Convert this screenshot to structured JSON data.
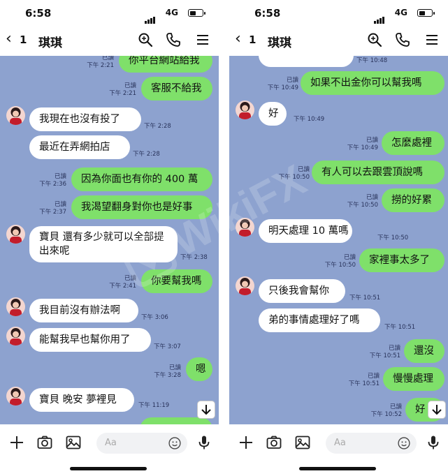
{
  "status_bar": {
    "time": "6:58",
    "network": "4G"
  },
  "chat_header": {
    "back_count": "1",
    "contact_name": "琪琪"
  },
  "composer": {
    "placeholder": "Aa"
  },
  "left_screen": {
    "messages": [
      {
        "dir": "out",
        "text": "你平台網站給我",
        "read": "已讀",
        "time": "下午 2:21"
      },
      {
        "dir": "out",
        "text": "客服不給我",
        "read": "已讀",
        "time": "下午 2:21"
      },
      {
        "dir": "in",
        "text": "我現在也沒有投了",
        "time": "下午 2:28"
      },
      {
        "dir": "in",
        "text": "最近在弄網拍店",
        "time": "下午 2:28"
      },
      {
        "dir": "out",
        "text": "因為你面也有你的 400 萬",
        "read": "已讀",
        "time": "下午 2:36"
      },
      {
        "dir": "out",
        "text": "我渴望翻身對你也是好事",
        "read": "已讀",
        "time": "下午 2:37"
      },
      {
        "dir": "in",
        "text": "寶貝 還有多少就可以全部提出來呢",
        "time": "下午 2:38"
      },
      {
        "dir": "out",
        "text": "你要幫我嗎",
        "read": "已讀",
        "time": "下午 2:41"
      },
      {
        "dir": "in",
        "text": "我目前沒有辦法啊",
        "time": "下午 3:06"
      },
      {
        "dir": "in",
        "text": "能幫我早也幫你用了",
        "time": "下午 3:07"
      },
      {
        "dir": "out",
        "text": "嗯",
        "read": "已讀",
        "time": "下午 3:28"
      },
      {
        "dir": "in",
        "text": "寶貝 晚安 夢裡見",
        "time": "下午 11:19"
      }
    ]
  },
  "right_screen": {
    "messages": [
      {
        "dir": "in",
        "text": "",
        "time": "下午 10:48"
      },
      {
        "dir": "out",
        "text": "如果不出金你可以幫我嗎",
        "read": "已讀",
        "time": "下午 10:49"
      },
      {
        "dir": "in",
        "text": "好",
        "time": "下午 10:49"
      },
      {
        "dir": "out",
        "text": "怎麼處裡",
        "read": "已讀",
        "time": "下午 10:49"
      },
      {
        "dir": "out",
        "text": "有人可以去跟雲頂說嗎",
        "read": "已讀",
        "time": "下午 10:50"
      },
      {
        "dir": "out",
        "text": "撈的好累",
        "read": "已讀",
        "time": "下午 10:50"
      },
      {
        "dir": "in",
        "text": "明天處理 10 萬嗎",
        "time": "下午 10:50"
      },
      {
        "dir": "out",
        "text": "家裡事太多了",
        "read": "已讀",
        "time": "下午 10:50"
      },
      {
        "dir": "in",
        "text": "只後我會幫你",
        "time": "下午 10:51"
      },
      {
        "dir": "in",
        "text": "弟的事情處理好了嗎",
        "time": "下午 10:51"
      },
      {
        "dir": "out",
        "text": "還沒",
        "read": "已讀",
        "time": "下午 10:51"
      },
      {
        "dir": "out",
        "text": "慢慢處理",
        "read": "已讀",
        "time": "下午 10:51"
      },
      {
        "dir": "out",
        "text": "好",
        "read": "已讀",
        "time": "下午 10:52"
      }
    ]
  },
  "watermark": "WikiFX",
  "colors": {
    "chat_bg": "#8da2cf",
    "incoming_bubble": "#ffffff",
    "outgoing_bubble": "#7fe06a",
    "read_text": "#28325a"
  },
  "icons": [
    "back-chevron-icon",
    "search-icon",
    "phone-icon",
    "menu-icon",
    "plus-icon",
    "camera-icon",
    "image-icon",
    "emoji-icon",
    "mic-icon",
    "scroll-down-icon",
    "avatar"
  ]
}
